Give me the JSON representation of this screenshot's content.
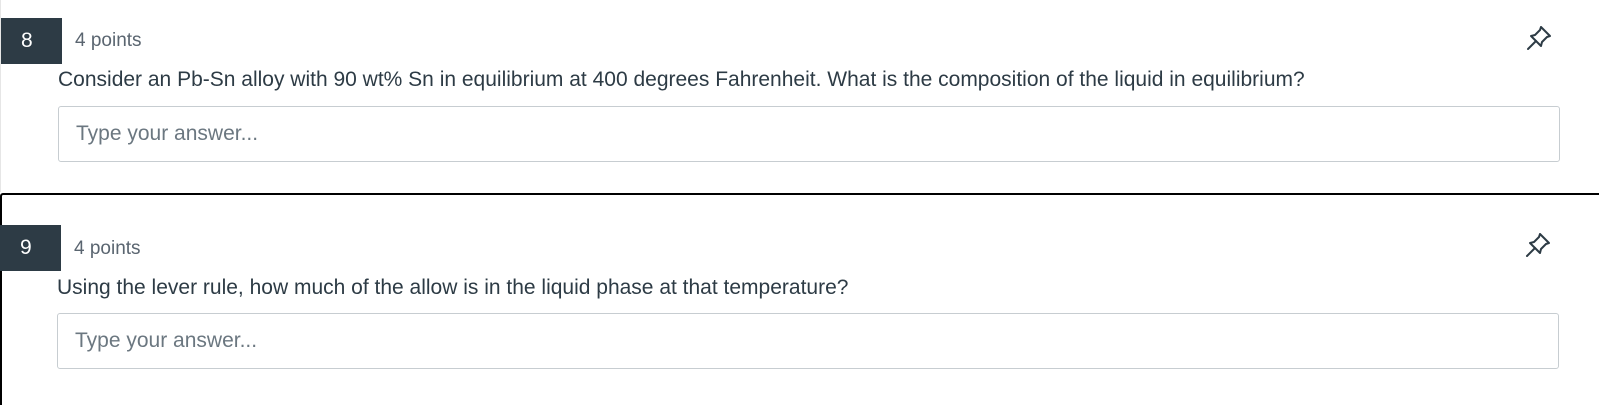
{
  "questions": [
    {
      "number": "8",
      "points": "4 points",
      "prompt": "Consider an Pb-Sn alloy with 90 wt% Sn in equilibrium at 400 degrees Fahrenheit. What is the composition of the liquid in equilibrium?",
      "answer_placeholder": "Type your answer...",
      "answer_value": "",
      "pin_icon": "pin-icon"
    },
    {
      "number": "9",
      "points": "4 points",
      "prompt": "Using the lever rule, how much of the allow is in the liquid phase at that temperature?",
      "answer_placeholder": "Type your answer...",
      "answer_value": "",
      "pin_icon": "pin-icon"
    }
  ],
  "colors": {
    "number_badge_bg": "#2d3b45",
    "text": "#2d3b45",
    "focus_border": "#000000"
  }
}
